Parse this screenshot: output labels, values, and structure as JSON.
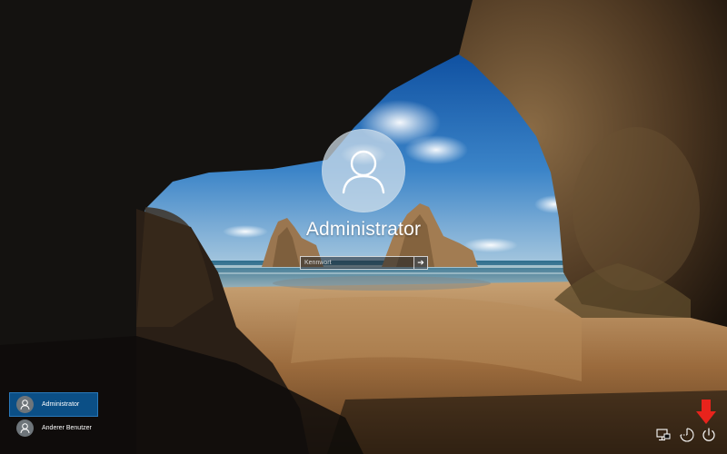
{
  "login": {
    "username": "Administrator",
    "password_placeholder": "Kennwort",
    "submit_icon": "arrow-right-icon"
  },
  "user_list": [
    {
      "name": "Administrator",
      "active": true
    },
    {
      "name": "Anderer Benutzer",
      "active": false
    }
  ],
  "system_icons": [
    "network-icon",
    "ease-of-access-icon",
    "power-icon"
  ],
  "annotation": {
    "icon": "red-arrow-down-icon",
    "color": "#e8231c"
  },
  "colors": {
    "selected_user_bg": "#0b4f86",
    "text": "#ffffff"
  }
}
